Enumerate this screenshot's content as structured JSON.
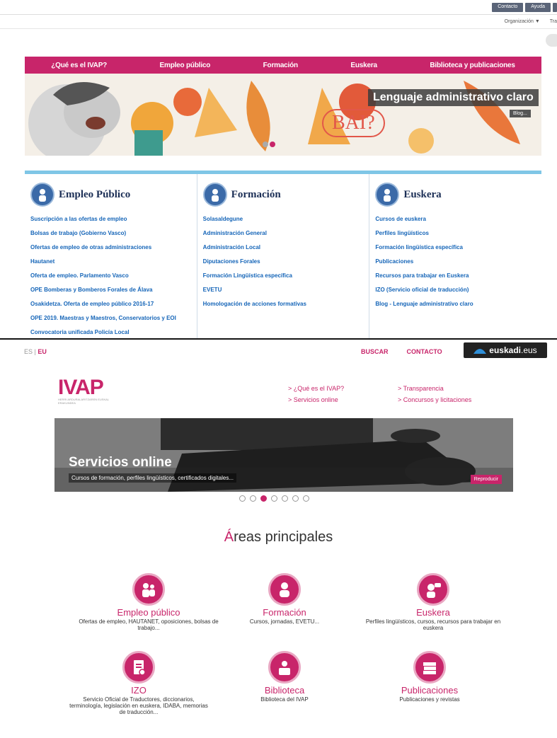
{
  "old_site": {
    "util_buttons": [
      "Contacto",
      "Ayuda",
      ""
    ],
    "org_menu": "Organización ▼",
    "org_trail": "Tra",
    "nav": [
      "¿Qué es el IVAP?",
      "Empleo público",
      "Formación",
      "Euskera",
      "Biblioteca y publicaciones"
    ],
    "banner": {
      "title": "Lenguaje administrativo claro",
      "blog_button": "Blog...",
      "bai_text": "BAI?"
    },
    "columns": [
      {
        "title": "Empleo Público",
        "links": [
          "Suscripción a las ofertas de empleo",
          "Bolsas de trabajo (Gobierno Vasco)",
          "Ofertas de empleo de otras administraciones",
          "Hautanet",
          "Oferta de empleo. Parlamento Vasco",
          "OPE Bomberas y Bomberos Forales de Álava",
          "Osakidetza. Oferta de empleo público 2016-17",
          "OPE 2019. Maestras y Maestros, Conservatorios y EOI",
          "Convocatoria unificada Policía Local"
        ]
      },
      {
        "title": "Formación",
        "links": [
          "Solasaldegune",
          "Administración General",
          "Administración Local",
          "Diputaciones Forales",
          "Formación Lingüística específica",
          "EVETU",
          "Homologación de acciones formativas"
        ]
      },
      {
        "title": "Euskera",
        "links": [
          "Cursos de euskera",
          "Perfiles lingüísticos",
          "Formación lingüística específica",
          "Publicaciones",
          "Recursos para trabajar en Euskera",
          "IZO (Servicio oficial de traducción)",
          "Blog - Lenguaje administrativo claro"
        ]
      }
    ]
  },
  "new_site": {
    "lang": {
      "es": "ES",
      "sep": " | ",
      "eu": "EU"
    },
    "top_links": [
      "BUSCAR",
      "CONTACTO"
    ],
    "euskadi": {
      "brand": "euskadi",
      "tld": ".eus"
    },
    "logo": {
      "text": "IVAP",
      "subtitle": "HERRI ARDURALARITZAREN EUSKAL ERAKUNDEA"
    },
    "quick_links_col1": [
      "> ¿Qué es el IVAP?",
      "> Servicios online"
    ],
    "quick_links_col2": [
      "> Transparencia",
      "> Concursos y licitaciones"
    ],
    "hero": {
      "title": "Servicios online",
      "subtitle": "Cursos de formación, perfiles lingüísticos, certificados digitales...",
      "button": "Reproducir",
      "dots": 7,
      "active_dot": 2
    },
    "areas_title_first": "Á",
    "areas_title_rest": "reas principales",
    "areas": [
      {
        "name": "Empleo público",
        "desc": "Ofertas de empleo, HAUTANET, oposiciones, bolsas de trabajo..."
      },
      {
        "name": "Formación",
        "desc": "Cursos, jornadas, EVETU..."
      },
      {
        "name": "Euskera",
        "desc": "Perfiles lingüísticos, cursos, recursos para trabajar en euskera"
      },
      {
        "name": "IZO",
        "desc": "Servicio Oficial de Traductores, diccionarios, terminología, legislación en euskera, IDABA, memorias de traducción..."
      },
      {
        "name": "Biblioteca",
        "desc": "Biblioteca del IVAP"
      },
      {
        "name": "Publicaciones",
        "desc": "Publicaciones y revistas"
      }
    ],
    "accent_color": "#c8256a"
  }
}
